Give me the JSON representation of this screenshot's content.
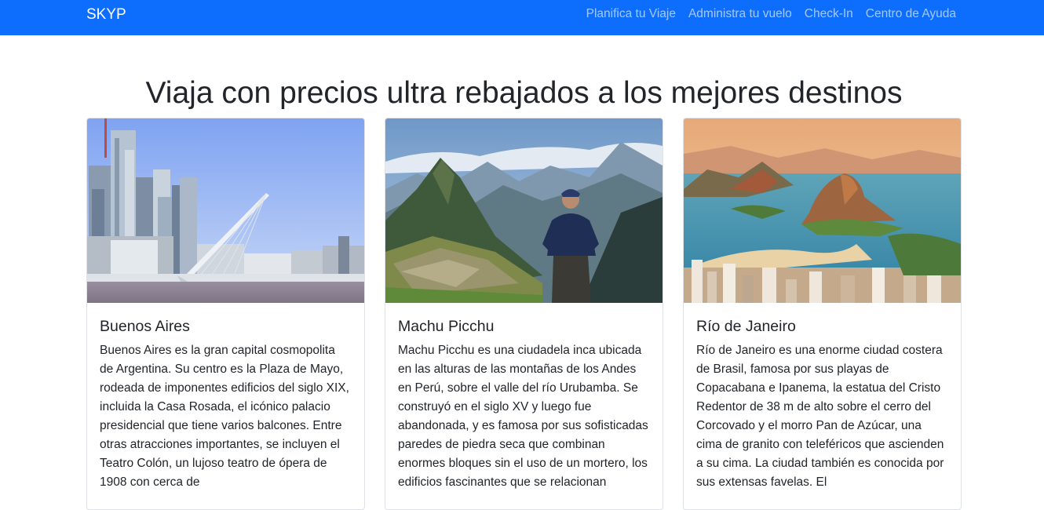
{
  "navbar": {
    "brand": "SKYP",
    "links": [
      "Planifica tu Viaje",
      "Administra tu vuelo",
      "Check-In",
      "Centro de Ayuda"
    ]
  },
  "page_title": "Viaja con precios ultra rebajados a los mejores destinos",
  "cards": [
    {
      "title": "Buenos Aires",
      "text": "Buenos Aires es la gran capital cosmopolita de Argentina. Su centro es la Plaza de Mayo, rodeada de imponentes edificios del siglo XIX, incluida la Casa Rosada, el icónico palacio presidencial que tiene varios balcones. Entre otras atracciones importantes, se incluyen el Teatro Colón, un lujoso teatro de ópera de 1908 con cerca de"
    },
    {
      "title": "Machu Picchu",
      "text": "Machu Picchu es una ciudadela inca ubicada en las alturas de las montañas de los Andes en Perú, sobre el valle del río Urubamba. Se construyó en el siglo XV y luego fue abandonada, y es famosa por sus sofisticadas paredes de piedra seca que combinan enormes bloques sin el uso de un mortero, los edificios fascinantes que se relacionan"
    },
    {
      "title": "Río de Janeiro",
      "text": "Río de Janeiro es una enorme ciudad costera de Brasil, famosa por sus playas de Copacabana e Ipanema, la estatua del Cristo Redentor de 38 m de alto sobre el cerro del Corcovado y el morro Pan de Azúcar, una cima de granito con teleféricos que ascienden a su cima. La ciudad también es conocida por sus extensas favelas. El"
    }
  ]
}
